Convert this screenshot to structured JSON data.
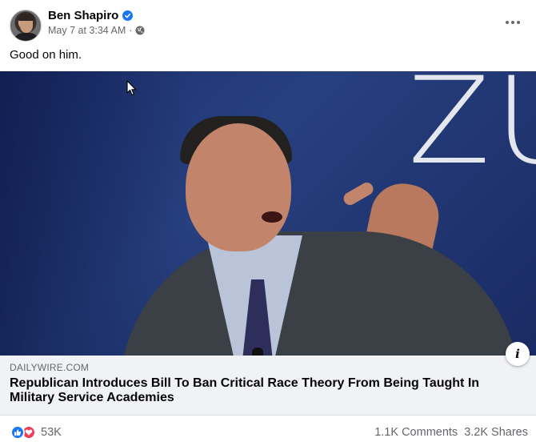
{
  "post": {
    "author": "Ben Shapiro",
    "verified": true,
    "timestamp": "May 7 at 3:34 AM",
    "separator": "·",
    "privacy_icon": "globe-icon",
    "more_icon": "more-horizontal-icon",
    "text": "Good on him."
  },
  "link_preview": {
    "domain": "DAILYWIRE.COM",
    "headline": "Republican Introduces Bill To Ban Critical Race Theory From Being Taught In Military Service Academies",
    "info_label": "i",
    "backdrop_text": "ZU"
  },
  "engagement": {
    "reaction_icons": [
      "like-icon",
      "love-icon"
    ],
    "reaction_count": "53K",
    "comments": "1.1K Comments",
    "shares": "3.2K Shares"
  },
  "colors": {
    "accent": "#1877f2",
    "love": "#f33e58",
    "secondary_text": "#65676b",
    "card_bg": "#f0f2f5"
  }
}
